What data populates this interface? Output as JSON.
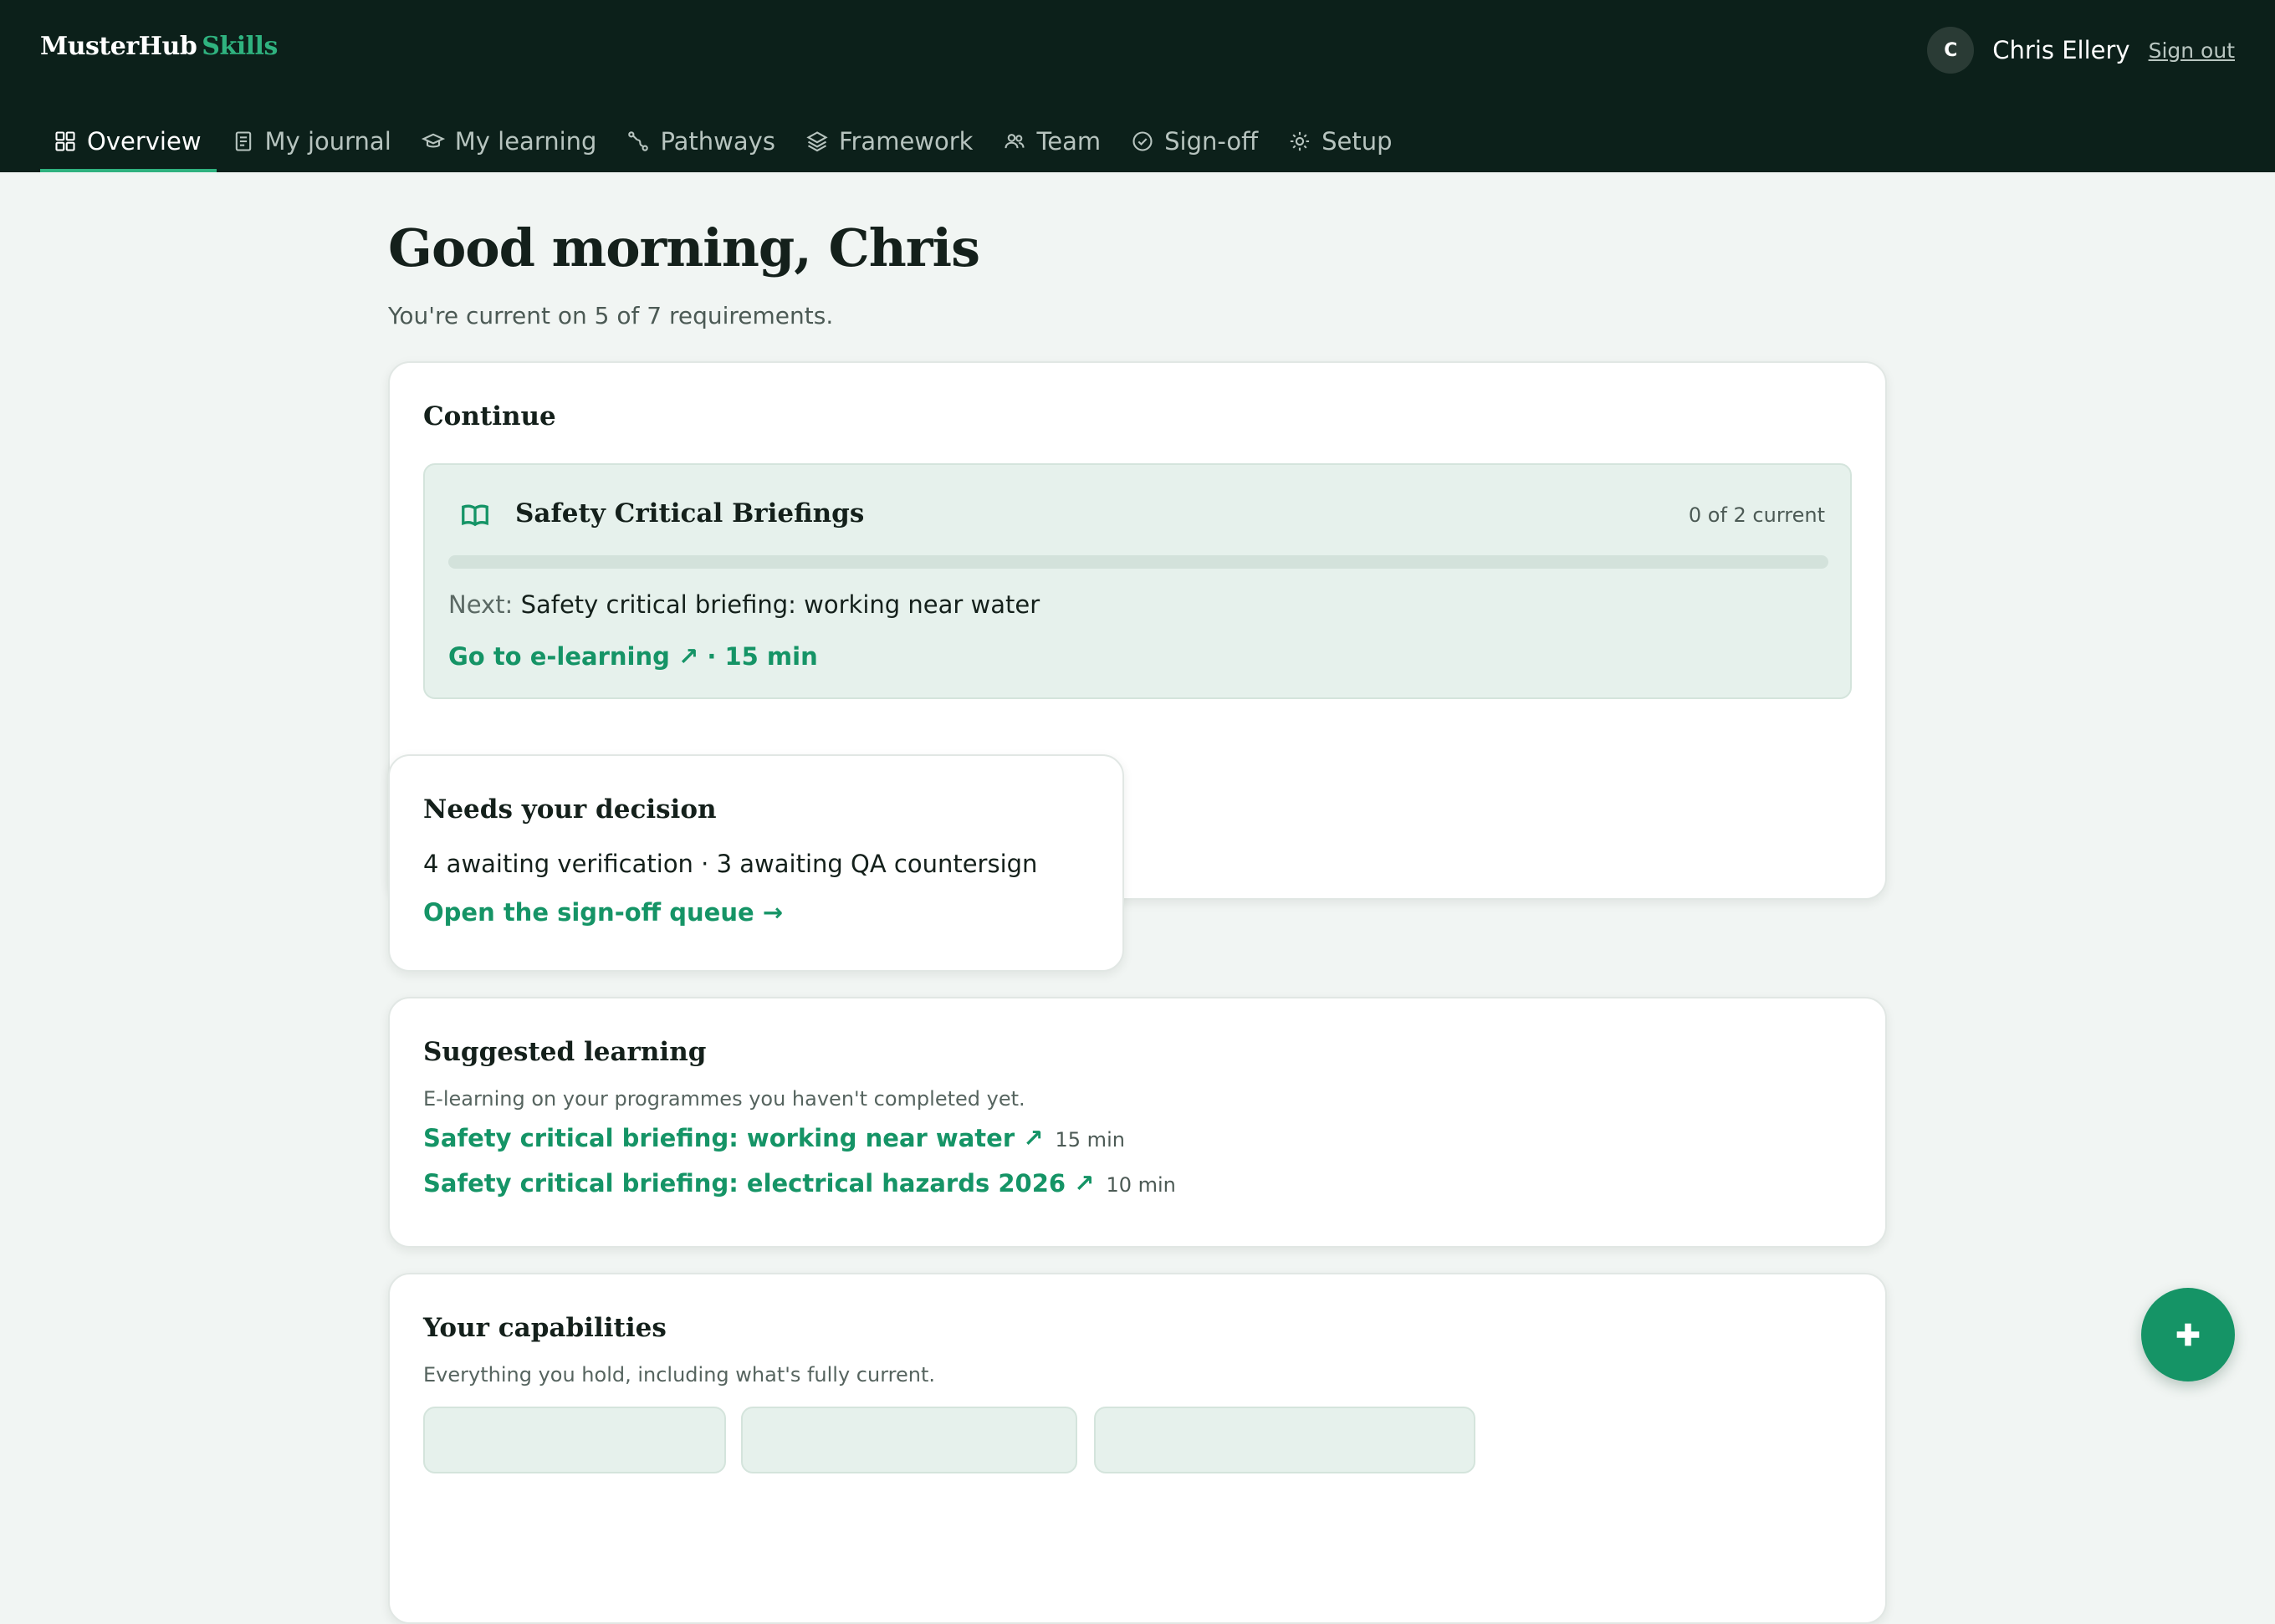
{
  "app": {
    "brand_name": "MusterHub",
    "brand_product": "Skills"
  },
  "user": {
    "initial": "C",
    "name": "Chris Ellery",
    "signout_label": "Sign out"
  },
  "nav": {
    "items": [
      {
        "label": "Overview",
        "icon": "grid-icon",
        "active": true
      },
      {
        "label": "My journal",
        "icon": "document-icon",
        "active": false
      },
      {
        "label": "My learning",
        "icon": "graduation-cap-icon",
        "active": false
      },
      {
        "label": "Pathways",
        "icon": "route-icon",
        "active": false
      },
      {
        "label": "Framework",
        "icon": "layers-icon",
        "active": false
      },
      {
        "label": "Team",
        "icon": "users-icon",
        "active": false
      },
      {
        "label": "Sign-off",
        "icon": "check-circle-icon",
        "active": false
      },
      {
        "label": "Setup",
        "icon": "sun-gear-icon",
        "active": false
      }
    ]
  },
  "page": {
    "greeting": "Good morning, Chris",
    "summary": "You're current on 5 of 7 requirements."
  },
  "continue_card": {
    "title": "Continue",
    "course_icon": "book-open-icon",
    "course_title": "Safety Critical Briefings",
    "course_count": "0 of 2 current",
    "progress_fraction": 0,
    "next_label": "Next:",
    "next_value": "Safety critical briefing: working near water",
    "go_label": "Go to e-learning ↗ · 15 min"
  },
  "decision_card": {
    "title": "Needs your decision",
    "summary": "4 awaiting verification · 3 awaiting QA countersign",
    "link_label": "Open the sign-off queue →"
  },
  "suggested_card": {
    "title": "Suggested learning",
    "subtitle": "E-learning on your programmes you haven't completed yet.",
    "items": [
      {
        "label": "Safety critical briefing: working near water ↗",
        "duration": "15 min"
      },
      {
        "label": "Safety critical briefing: electrical hazards 2026 ↗",
        "duration": "10 min"
      }
    ]
  },
  "capabilities_card": {
    "title": "Your capabilities",
    "subtitle": "Everything you hold, including what's fully current."
  },
  "fab": {
    "icon": "plus-icon"
  },
  "colors": {
    "header_bg": "#0c201a",
    "accent": "#159466",
    "brand_accent": "#2fb27f",
    "page_bg": "#f1f5f3"
  }
}
